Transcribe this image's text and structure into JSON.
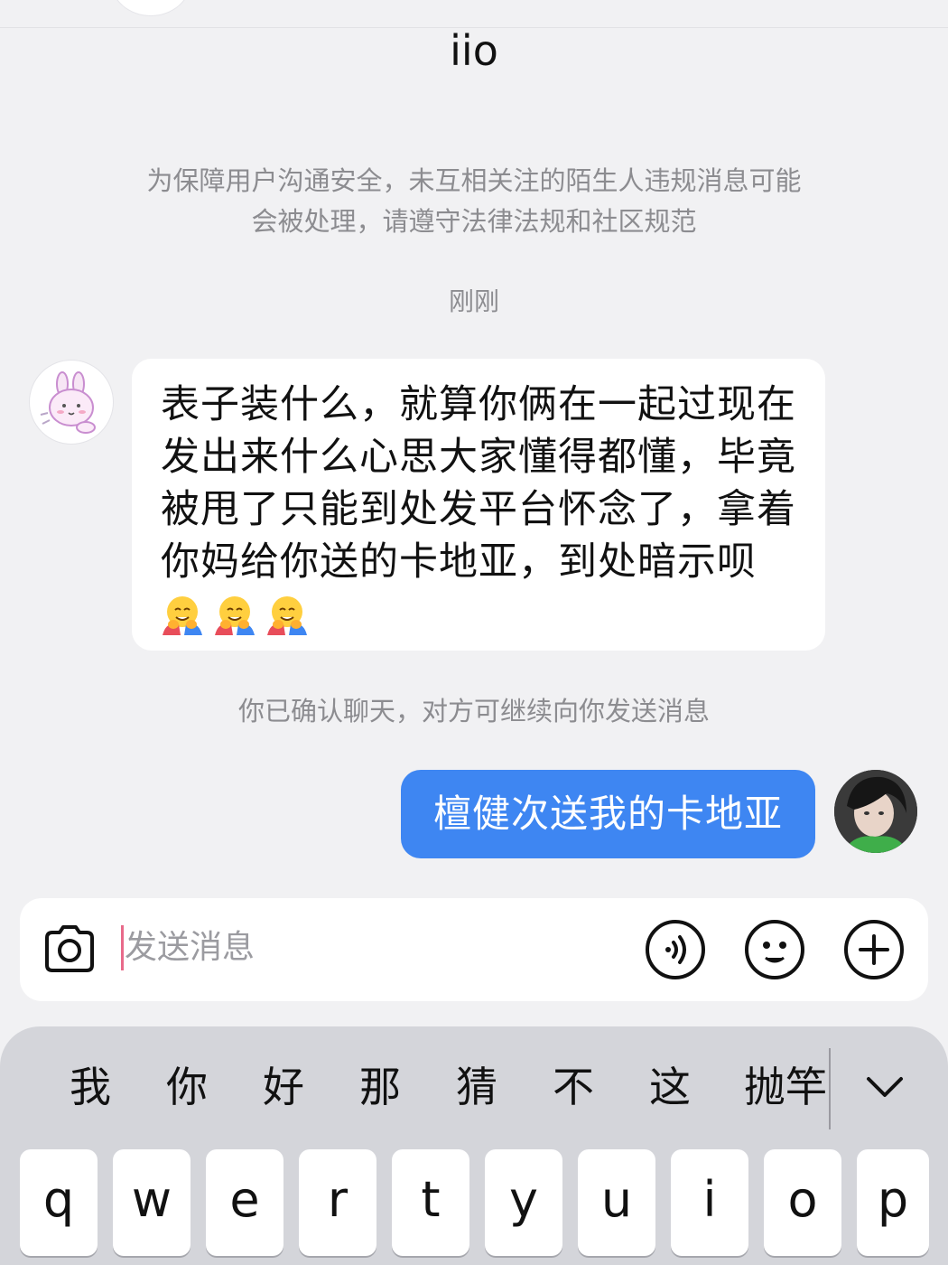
{
  "header": {
    "title": "iio"
  },
  "notice": {
    "line1": "为保障用户沟通安全，未互相关注的陌生人违规消息可能",
    "line2": "会被处理，请遵守法律法规和社区规范"
  },
  "timestamp": "刚刚",
  "messages": {
    "incoming": {
      "lines": [
        "表子装什么，就算你俩在一起过现在",
        "发出来什么心思大家懂得都懂，毕竟",
        "被甩了只能到处发平台怀念了，拿着",
        "你妈给你送的卡地亚，到处暗示呗"
      ],
      "emoji_count": 3,
      "emoji_name": "hugging-face-emoji"
    },
    "system": "你已确认聊天，对方可继续向你发送消息",
    "outgoing": {
      "text": "檀健次送我的卡地亚"
    }
  },
  "input": {
    "placeholder": "发送消息",
    "icons": [
      "camera-icon",
      "voice-icon",
      "emoji-icon",
      "plus-icon"
    ]
  },
  "keyboard": {
    "candidates": [
      "我",
      "你",
      "好",
      "那",
      "猜",
      "不",
      "这",
      "抛竿"
    ],
    "keys": [
      "q",
      "w",
      "e",
      "r",
      "t",
      "y",
      "u",
      "i",
      "o",
      "p"
    ]
  },
  "colors": {
    "outgoing_bubble": "#3e86f2",
    "background": "#f1f1f3",
    "keyboard": "#d4d5da"
  }
}
